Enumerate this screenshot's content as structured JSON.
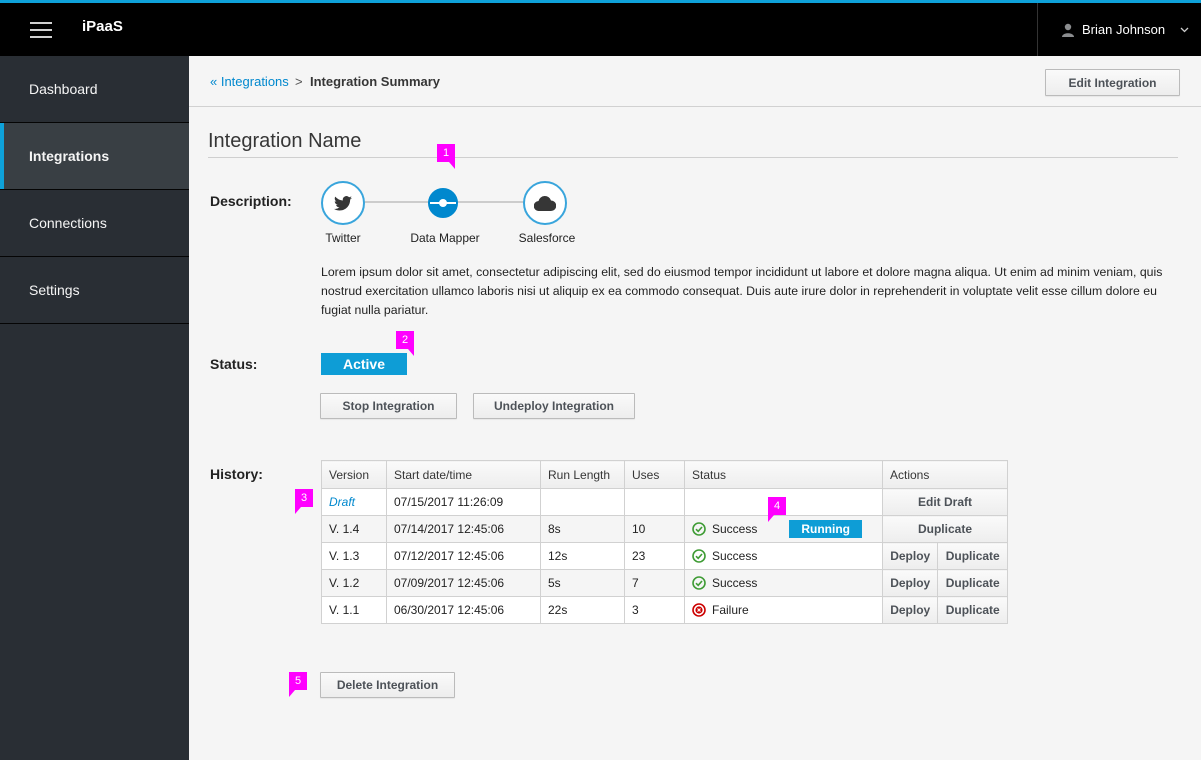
{
  "app": {
    "brand": "iPaaS",
    "user_name": "Brian Johnson",
    "accent": "#0ea1d9"
  },
  "sidebar": {
    "items": [
      {
        "label": "Dashboard",
        "active": false
      },
      {
        "label": "Integrations",
        "active": true
      },
      {
        "label": "Connections",
        "active": false
      },
      {
        "label": "Settings",
        "active": false
      }
    ]
  },
  "breadcrumb": {
    "back_label": "« Integrations",
    "separator": ">",
    "current": "Integration Summary"
  },
  "toolbar": {
    "edit_label": "Edit Integration"
  },
  "page": {
    "title": "Integration Name"
  },
  "description": {
    "label": "Description:",
    "steps": [
      {
        "label": "Twitter",
        "icon": "twitter-icon"
      },
      {
        "label": "Data Mapper",
        "icon": "data-mapper-icon"
      },
      {
        "label": "Salesforce",
        "icon": "cloud-icon"
      }
    ],
    "text": "Lorem ipsum dolor sit amet, consectetur adipiscing elit, sed do eiusmod tempor incididunt ut labore et dolore magna aliqua. Ut enim ad minim veniam, quis nostrud exercitation ullamco laboris nisi ut aliquip ex ea commodo consequat. Duis aute irure dolor in reprehenderit in voluptate velit esse cillum dolore eu fugiat nulla pariatur."
  },
  "status": {
    "label": "Status:",
    "value": "Active",
    "stop_label": "Stop Integration",
    "undeploy_label": "Undeploy Integration"
  },
  "history": {
    "label": "History:",
    "columns": [
      "Version",
      "Start date/time",
      "Run Length",
      "Uses",
      "Status",
      "Actions"
    ],
    "rows": [
      {
        "version": "Draft",
        "start": "07/15/2017 11:26:09",
        "run_length": "",
        "uses": "",
        "status": "",
        "badge": "",
        "actions": [
          "Edit Draft"
        ]
      },
      {
        "version": "V. 1.4",
        "start": "07/14/2017 12:45:06",
        "run_length": "8s",
        "uses": "10",
        "status": "Success",
        "badge": "Running",
        "actions": [
          "Duplicate"
        ]
      },
      {
        "version": "V. 1.3",
        "start": "07/12/2017 12:45:06",
        "run_length": "12s",
        "uses": "23",
        "status": "Success",
        "badge": "",
        "actions": [
          "Deploy",
          "Duplicate"
        ]
      },
      {
        "version": "V. 1.2",
        "start": "07/09/2017 12:45:06",
        "run_length": "5s",
        "uses": "7",
        "status": "Success",
        "badge": "",
        "actions": [
          "Deploy",
          "Duplicate"
        ]
      },
      {
        "version": "V. 1.1",
        "start": "06/30/2017 12:45:06",
        "run_length": "22s",
        "uses": "3",
        "status": "Failure",
        "badge": "",
        "actions": [
          "Deploy",
          "Duplicate"
        ]
      }
    ]
  },
  "delete_label": "Delete Integration",
  "annotations": [
    "1",
    "2",
    "3",
    "4",
    "5"
  ],
  "colors": {
    "success": "#3f9c35",
    "failure": "#cc0000",
    "badge": "#0e9dd6",
    "annotation": "#ff00ff"
  }
}
